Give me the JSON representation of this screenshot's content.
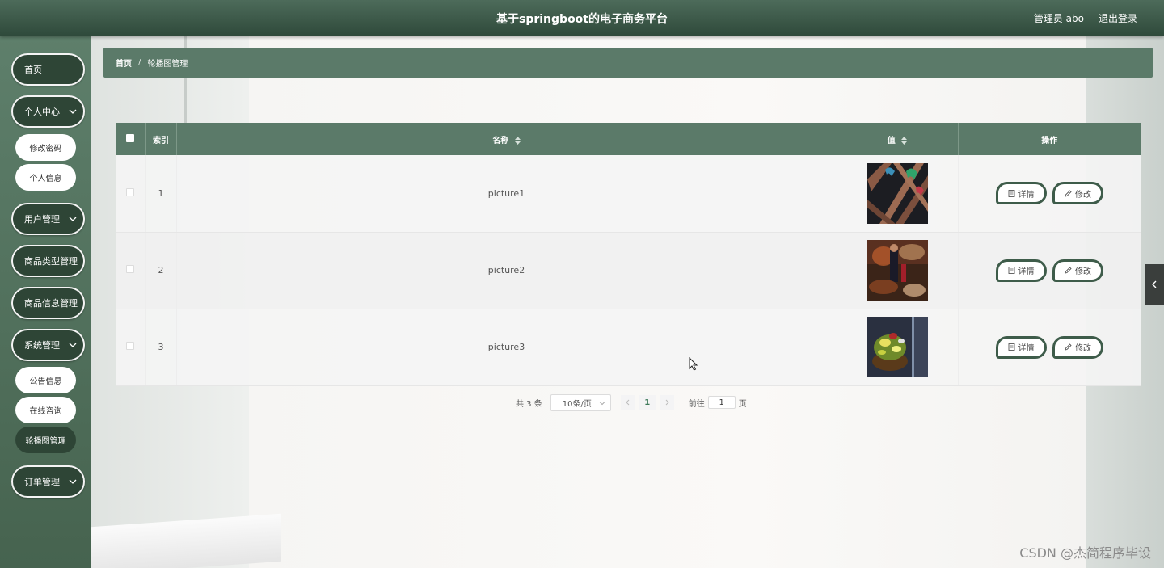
{
  "header": {
    "title": "基于springboot的电子商务平台",
    "user": "管理员 abo",
    "logout": "退出登录"
  },
  "sidebar": {
    "items": [
      {
        "label": "首页"
      },
      {
        "label": "个人中心",
        "children": [
          {
            "label": "修改密码"
          },
          {
            "label": "个人信息"
          }
        ]
      },
      {
        "label": "用户管理"
      },
      {
        "label": "商品类型管理"
      },
      {
        "label": "商品信息管理"
      },
      {
        "label": "系统管理",
        "children": [
          {
            "label": "公告信息"
          },
          {
            "label": "在线咨询"
          },
          {
            "label": "轮播图管理",
            "active": true
          }
        ]
      },
      {
        "label": "订单管理"
      }
    ]
  },
  "breadcrumb": {
    "home": "首页",
    "separator": "/",
    "current": "轮播图管理"
  },
  "table": {
    "columns": {
      "index": "索引",
      "name": "名称",
      "value": "值",
      "actions": "操作"
    },
    "rows": [
      {
        "index": "1",
        "name": "picture1",
        "image": "thumbnail-1"
      },
      {
        "index": "2",
        "name": "picture2",
        "image": "thumbnail-2"
      },
      {
        "index": "3",
        "name": "picture3",
        "image": "thumbnail-3"
      }
    ],
    "detail_label": "详情",
    "edit_label": "修改"
  },
  "pagination": {
    "total": "共 3 条",
    "page_size": "10条/页",
    "current_page": "1",
    "goto_prefix": "前往",
    "goto_value": "1",
    "goto_suffix": "页"
  },
  "watermark": "CSDN @杰简程序毕设",
  "colors": {
    "header_bg": "#3c5a48",
    "sidebar_bg": "#567563",
    "accent": "#5b7a69",
    "pill_dark": "#2e4536"
  }
}
